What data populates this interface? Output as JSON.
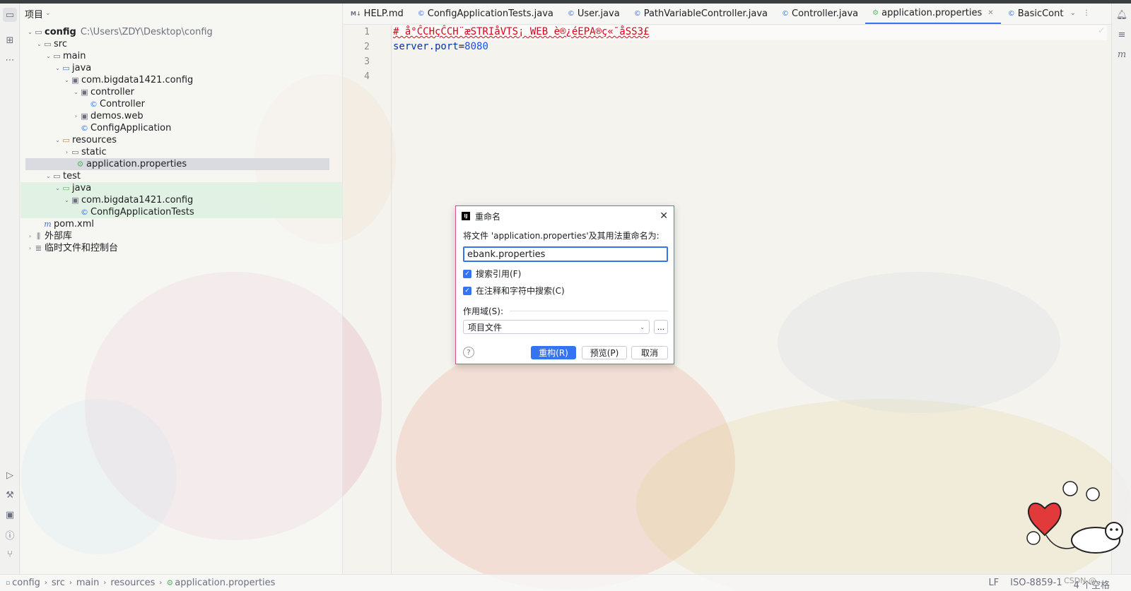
{
  "project_panel": {
    "title": "项目",
    "tree": [
      {
        "label": "config",
        "path": "C:\\Users\\ZDY\\Desktop\\config",
        "bold": true
      },
      {
        "label": "src"
      },
      {
        "label": "main"
      },
      {
        "label": "java"
      },
      {
        "label": "com.bigdata1421.config"
      },
      {
        "label": "controller"
      },
      {
        "label": "Controller"
      },
      {
        "label": "demos.web"
      },
      {
        "label": "ConfigApplication"
      },
      {
        "label": "resources"
      },
      {
        "label": "static"
      },
      {
        "label": "application.properties",
        "selected": true
      },
      {
        "label": "test"
      },
      {
        "label": "java"
      },
      {
        "label": "com.bigdata1421.config"
      },
      {
        "label": "ConfigApplicationTests"
      },
      {
        "label": "pom.xml"
      },
      {
        "label": "外部库"
      },
      {
        "label": "临时文件和控制台"
      }
    ]
  },
  "tabs": [
    {
      "label": "HELP.md",
      "icon": "M↓"
    },
    {
      "label": "ConfigApplicationTests.java",
      "icon": "©"
    },
    {
      "label": "User.java",
      "icon": "©"
    },
    {
      "label": "PathVariableController.java",
      "icon": "©"
    },
    {
      "label": "Controller.java",
      "icon": "©"
    },
    {
      "label": "application.properties",
      "icon": "⚙",
      "active": true
    },
    {
      "label": "BasicCont",
      "icon": "©"
    }
  ],
  "editor": {
    "line_numbers": [
      "1",
      "2",
      "3",
      "4"
    ],
    "line1_comment": "# å°ĈCHçĈCH¨æSTRIåVTS¡ WEB è®¿éEPA®ç«¯åSS3£",
    "line2_key": "server.port",
    "line2_eq": "=",
    "line2_value": "8080"
  },
  "dialog": {
    "title": "重命名",
    "prompt": "将文件 'application.properties'及其用法重命名为:",
    "input_value": "ebank.properties",
    "check1_label": "搜索引用(F)",
    "check2_label": "在注释和字符中搜索(C)",
    "scope_label": "作用域(S):",
    "scope_value": "项目文件",
    "more_label": "...",
    "help_label": "?",
    "refactor_label": "重构(R)",
    "preview_label": "预览(P)",
    "cancel_label": "取消"
  },
  "status_bar": {
    "breadcrumbs": [
      "config",
      "src",
      "main",
      "resources",
      "application.properties"
    ],
    "line_ending": "LF",
    "encoding": "ISO-8859-1",
    "indent": "4 个空格"
  },
  "watermark": "CSDN @...",
  "colors": {
    "accent": "#3574f0",
    "dialog_border": "#d64f8d",
    "comment_red": "#e0001a"
  }
}
